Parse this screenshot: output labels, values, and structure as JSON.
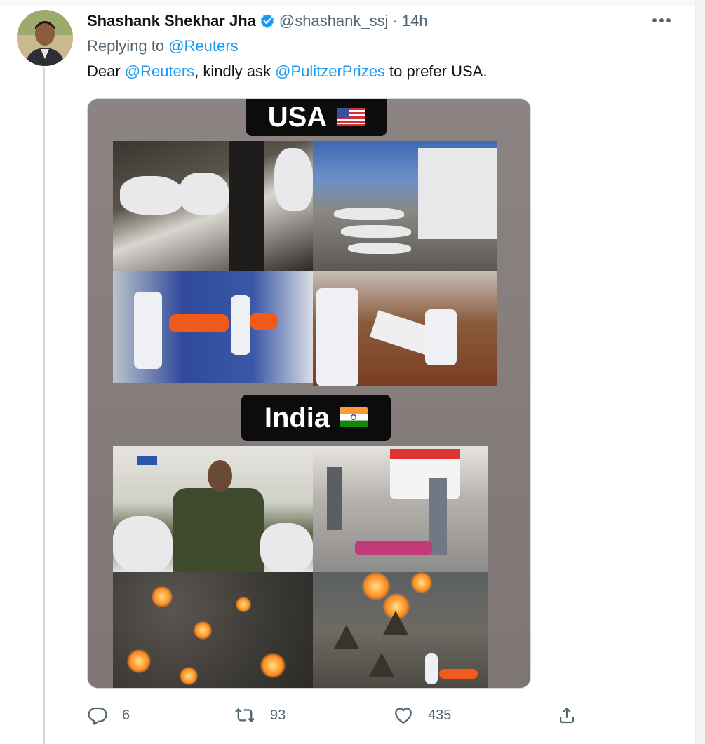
{
  "tweet": {
    "author_name": "Shashank Shekhar Jha",
    "author_handle": "@shashank_ssj",
    "separator": "·",
    "time": "14h",
    "replying_prefix": "Replying to",
    "replying_to": "@Reuters",
    "text_parts": {
      "p1": "Dear ",
      "m1": "@Reuters",
      "p2": ", kindly ask ",
      "m2": "@PulitzerPrizes",
      "p3": " to prefer USA."
    }
  },
  "media": {
    "banner_top": "USA",
    "banner_bottom": "India"
  },
  "actions": {
    "replies": "6",
    "retweets": "93",
    "likes": "435"
  },
  "icons": {
    "verified": "verified-badge-icon",
    "more": "more-options-icon",
    "reply": "reply-icon",
    "retweet": "retweet-icon",
    "like": "heart-icon",
    "share": "share-icon"
  },
  "colors": {
    "link": "#1d9bf0",
    "secondary_text": "#536471",
    "primary_text": "#0f1419",
    "thread_line": "#cfd9de"
  }
}
